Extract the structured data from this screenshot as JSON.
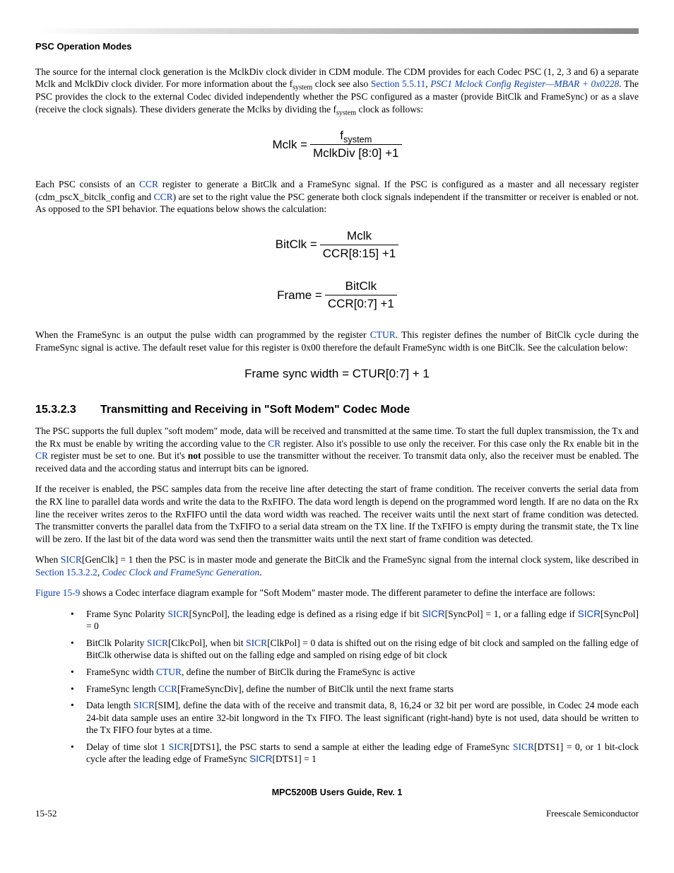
{
  "runningHead": "PSC Operation Modes",
  "p1_a": "The source for the internal clock generation is the MclkDiv clock divider in CDM module. The CDM provides for each Codec PSC (1, 2, 3 and 6) a separate Mclk and MclkDiv clock divider. For more information about the f",
  "p1_sub1": "system",
  "p1_b": " clock see also ",
  "p1_link1": "Section 5.5.11",
  "p1_c": ", ",
  "p1_link2": "PSC1 Mclock Config Register—MBAR + 0x0228",
  "p1_d": ". The PSC provides the clock to the external Codec divided independently whether the PSC configured as a master (provide BitClk and FrameSync) or as a slave (receive the clock signals). These dividers generate the Mclks by dividing the f",
  "p1_sub2": "system",
  "p1_e": " clock as follows:",
  "eq1_lhs": "Mclk = ",
  "eq1_num_a": "f",
  "eq1_num_sub": "system",
  "eq1_den": "MclkDiv [8:0] +1",
  "p2_a": "Each PSC consists of an ",
  "p2_link1": "CCR",
  "p2_b": " register to generate a BitClk and a FrameSync signal. If the PSC is configured as a master and all necessary register (cdm_pscX_bitclk_config and ",
  "p2_link2": "CCR",
  "p2_c": ") are set to the right value the PSC generate both clock signals independent if the transmitter or receiver is enabled or not. As opposed to the SPI behavior. The equations below shows the calculation:",
  "eq2_lhs": "BitClk = ",
  "eq2_num": "Mclk",
  "eq2_den": "CCR[8:15] +1",
  "eq3_lhs": "Frame = ",
  "eq3_num": "BitClk",
  "eq3_den": "CCR[0:7] +1",
  "p3_a": "When the FrameSync is an output the pulse width can programmed by the register ",
  "p3_link1": "CTUR",
  "p3_b": ". This register defines the number of BitClk cycle during the FrameSync signal is active. The default reset value for this register is 0x00 therefore the default FrameSync width is one BitClk. See the calculation below:",
  "eq4": "Frame sync width = CTUR[0:7] + 1",
  "secNum": "15.3.2.3",
  "secTitle": "Transmitting and Receiving in \"Soft Modem\" Codec Mode",
  "p4_a": "The PSC supports the full duplex \"soft modem\" mode, data will be received and transmitted at the same time. To start the full duplex transmission, the Tx and the Rx must be enable by writing the according value to the ",
  "p4_link1": "CR",
  "p4_b": " register. Also it's possible to use only the receiver. For this case only the Rx enable bit in the ",
  "p4_link2": "CR",
  "p4_c": " register must be set to one. But it's ",
  "p4_bold": "not",
  "p4_d": " possible to use the transmitter without the receiver. To transmit data only, also the receiver must be enabled. The received data and the according status and interrupt bits can be ignored.",
  "p5": "If the receiver is enabled, the PSC samples data from the receive line after detecting the start of frame condition. The receiver converts the serial data from the RX line to parallel data words and write the data to the RxFIFO. The data word length is depend on the programmed word length. If are no data on the Rx line the receiver writes zeros to the RxFIFO until the data word width was reached. The receiver waits until the next start of frame condition was detected. The transmitter converts the parallel data from the TxFIFO to a serial data stream on the TX line. If the TxFIFO is empty during the transmit state, the Tx line will be zero. If the last bit of the data word was send then the transmitter waits until the next start of frame condition was detected.",
  "p6_a": "When ",
  "p6_link1": "SICR",
  "p6_b": "[GenClk] = 1 then the PSC is in master mode and generate the BitClk and the FrameSync signal from the internal clock system, like described in ",
  "p6_link2": "Section 15.3.2.2",
  "p6_c": ", ",
  "p6_link3": "Codec Clock and FrameSync Generation",
  "p6_d": ".",
  "p7_link1": "Figure 15-9",
  "p7_a": " shows a Codec interface diagram example for \"Soft Modem\" master mode. The different parameter to define the interface are follows:",
  "b1_a": "Frame Sync Polarity ",
  "b1_link1": "SICR",
  "b1_b": "[SyncPol], the leading edge is defined as a rising edge if bit ",
  "b1_link2": "SICR",
  "b1_c": "[SyncPol] = 1, or a falling edge if ",
  "b1_link3": "SICR",
  "b1_d": "[SyncPol] = 0",
  "b2_a": "BitClk Polarity ",
  "b2_link1": "SICR",
  "b2_b": "[ClkcPol], when bit ",
  "b2_link2": "SICR",
  "b2_c": "[ClkPol] = 0 data is shifted out on the rising edge of bit clock and sampled on the falling edge of BitClk otherwise data is shifted out on the falling edge and sampled on rising edge of bit clock",
  "b3_a": "FrameSync width ",
  "b3_link1": "CTUR",
  "b3_b": ", define the number of BitClk during the FrameSync is active",
  "b4_a": "FrameSync length ",
  "b4_link1": "CCR",
  "b4_b": "[FrameSyncDiv], define the number of BitClk until the next frame starts",
  "b5_a": "Data length ",
  "b5_link1": "SICR",
  "b5_b": "[SIM], define the data with of the receive and transmit data, 8, 16,24 or 32 bit per word are possible, in Codec 24 mode each 24-bit data sample uses an entire 32-bit longword in the Tx FIFO. The least significant (right-hand) byte is not used, data should be written to the Tx FIFO four bytes at a time.",
  "b6_a": "Delay of time slot 1 ",
  "b6_link1": "SICR",
  "b6_b": "[DTS1], the PSC starts to send a sample at either the leading edge of FrameSync ",
  "b6_link2": "SICR",
  "b6_c": "[DTS1] = 0, or 1 bit-clock cycle after the leading edge of FrameSync ",
  "b6_link3": "SICR",
  "b6_d": "[DTS1] = 1",
  "footerTitle": "MPC5200B Users Guide, Rev. 1",
  "pageNum": "15-52",
  "company": "Freescale Semiconductor"
}
